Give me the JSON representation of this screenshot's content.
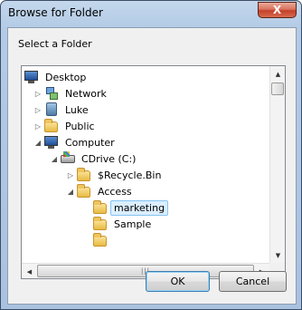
{
  "window": {
    "title": "Browse for Folder",
    "close_symbol": "X"
  },
  "prompt": "Select a Folder",
  "tree": {
    "items": [
      {
        "label": "Desktop",
        "icon": "desktop-icon",
        "expander": ""
      },
      {
        "label": "Network",
        "icon": "network-icon",
        "expander": "▷"
      },
      {
        "label": "Luke",
        "icon": "user-folder-icon",
        "expander": "▷"
      },
      {
        "label": "Public",
        "icon": "folder-icon",
        "expander": "▷"
      },
      {
        "label": "Computer",
        "icon": "computer-icon",
        "expander": "◢"
      },
      {
        "label": "CDrive (C:)",
        "icon": "drive-icon",
        "expander": "◢"
      },
      {
        "label": "$Recycle.Bin",
        "icon": "folder-icon",
        "expander": "▷"
      },
      {
        "label": "Access",
        "icon": "folder-icon",
        "expander": "◢"
      },
      {
        "label": "marketing",
        "icon": "folder-icon",
        "expander": "",
        "selected": true
      },
      {
        "label": "Sample",
        "icon": "folder-icon",
        "expander": ""
      }
    ]
  },
  "scroll": {
    "up_arrow": "▲",
    "down_arrow": "▼",
    "left_arrow": "◀",
    "right_arrow": "▶",
    "grip": "|||"
  },
  "buttons": {
    "ok": "OK",
    "cancel": "Cancel"
  },
  "colors": {
    "selection_bg": "#dbeeff",
    "selection_border": "#84c4f2",
    "close_red": "#c4402a"
  }
}
